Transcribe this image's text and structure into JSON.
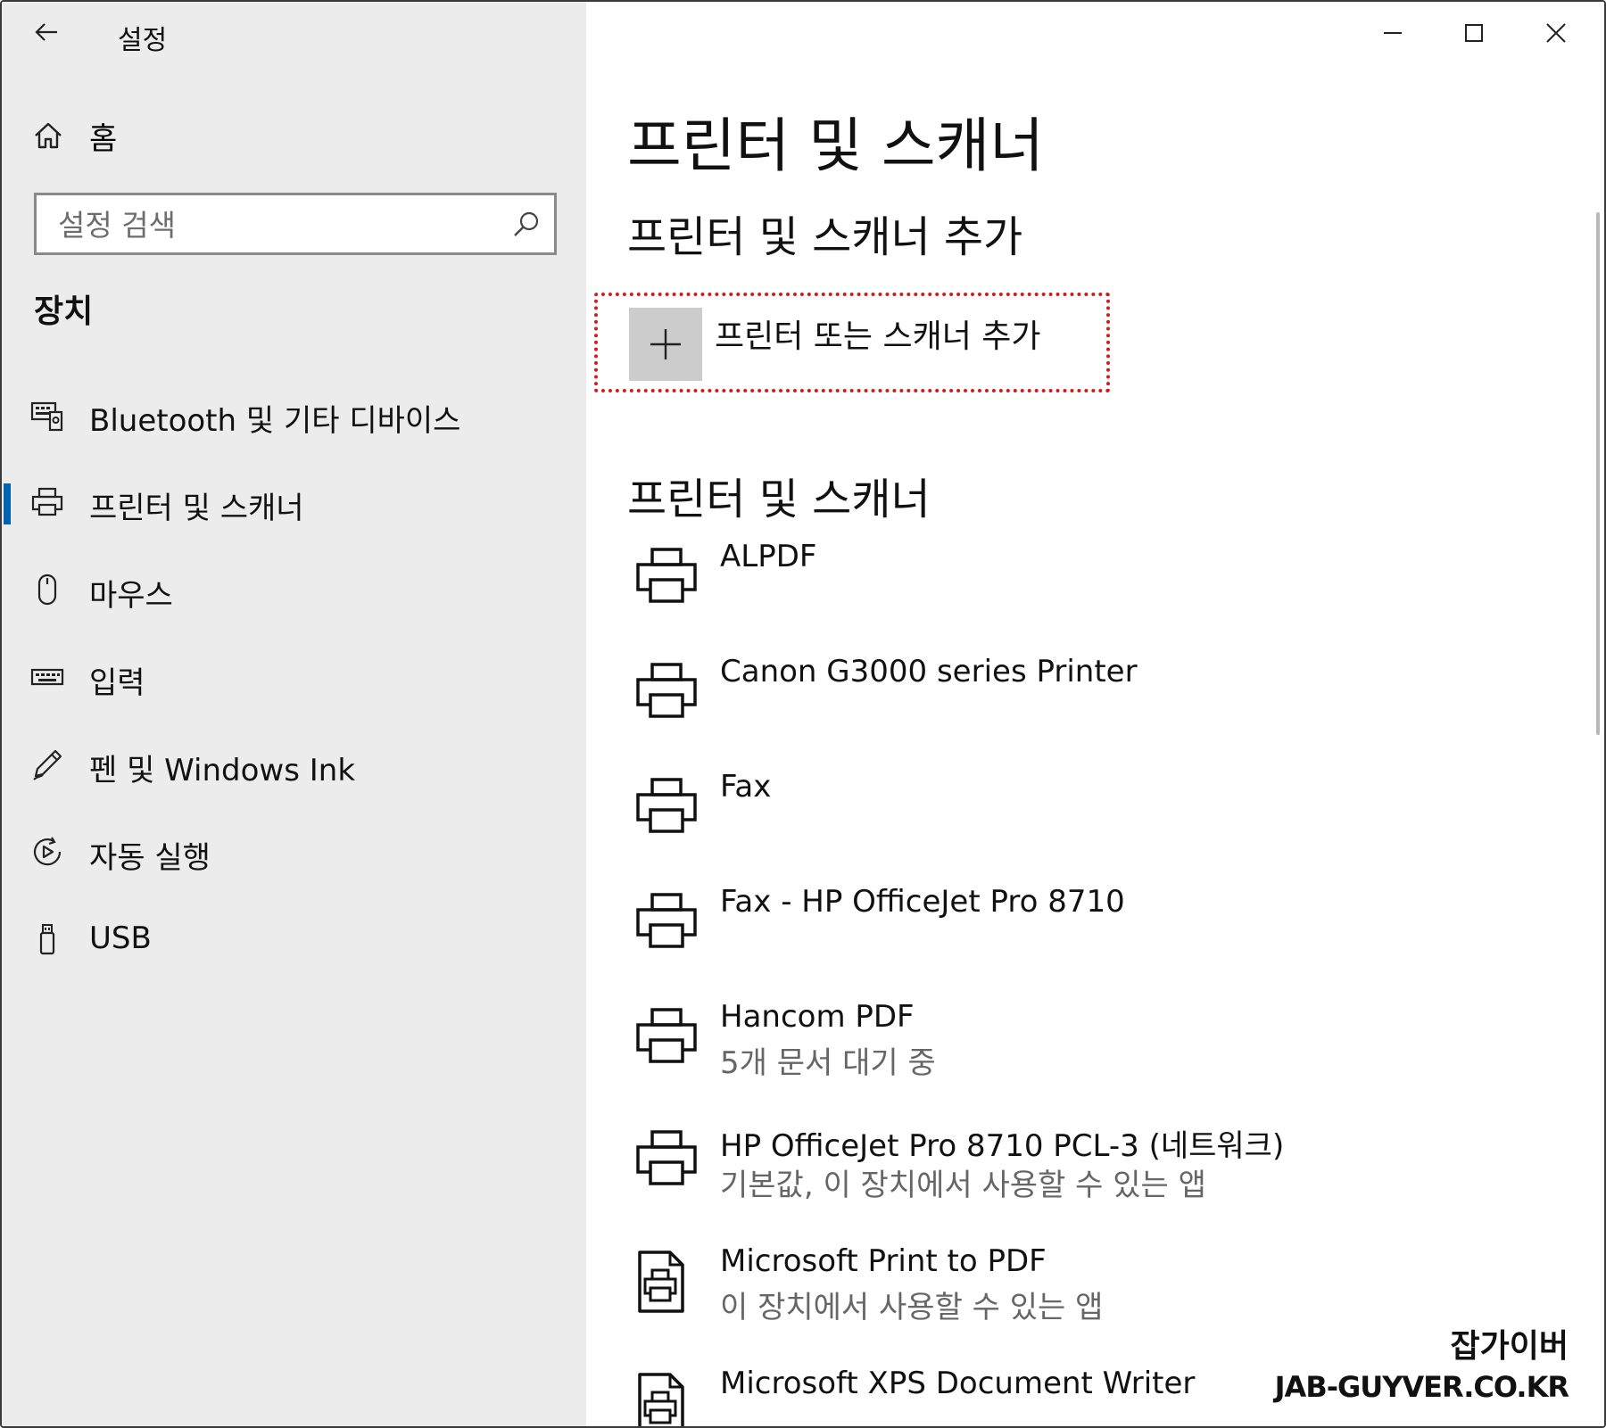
{
  "window": {
    "title": "설정"
  },
  "sidebar": {
    "home_label": "홈",
    "search_placeholder": "설정 검색",
    "section_title": "장치",
    "items": [
      {
        "label": "Bluetooth 및 기타 디바이스",
        "icon": "bluetooth-devices-icon",
        "active": false
      },
      {
        "label": "프린터 및 스캐너",
        "icon": "printer-icon",
        "active": true
      },
      {
        "label": "마우스",
        "icon": "mouse-icon",
        "active": false
      },
      {
        "label": "입력",
        "icon": "keyboard-icon",
        "active": false
      },
      {
        "label": "펜 및 Windows Ink",
        "icon": "pen-icon",
        "active": false
      },
      {
        "label": "자동 실행",
        "icon": "autoplay-icon",
        "active": false
      },
      {
        "label": "USB",
        "icon": "usb-icon",
        "active": false
      }
    ]
  },
  "content": {
    "page_title": "프린터 및 스캐너",
    "add_section_title": "프린터 및 스캐너 추가",
    "add_button_label": "프린터 또는 스캐너 추가",
    "list_section_title": "프린터 및 스캐너",
    "printers": [
      {
        "name": "ALPDF",
        "status": "",
        "icon": "printer-icon"
      },
      {
        "name": "Canon G3000 series Printer",
        "status": "",
        "icon": "printer-icon"
      },
      {
        "name": "Fax",
        "status": "",
        "icon": "printer-icon"
      },
      {
        "name": "Fax - HP OfficeJet Pro 8710",
        "status": "",
        "icon": "printer-icon"
      },
      {
        "name": "Hancom PDF",
        "status": "5개 문서 대기 중",
        "icon": "printer-icon"
      },
      {
        "name": "HP OfficeJet Pro 8710 PCL-3 (네트워크)",
        "status": "기본값, 이 장치에서 사용할 수 있는 앱",
        "icon": "printer-icon"
      },
      {
        "name": "Microsoft Print to PDF",
        "status": "이 장치에서 사용할 수 있는 앱",
        "icon": "document-printer-icon"
      },
      {
        "name": "Microsoft XPS Document Writer",
        "status": "",
        "icon": "document-printer-icon"
      }
    ]
  },
  "watermark": {
    "line1": "잡가이버",
    "line2": "JAB-GUYVER.CO.KR"
  }
}
